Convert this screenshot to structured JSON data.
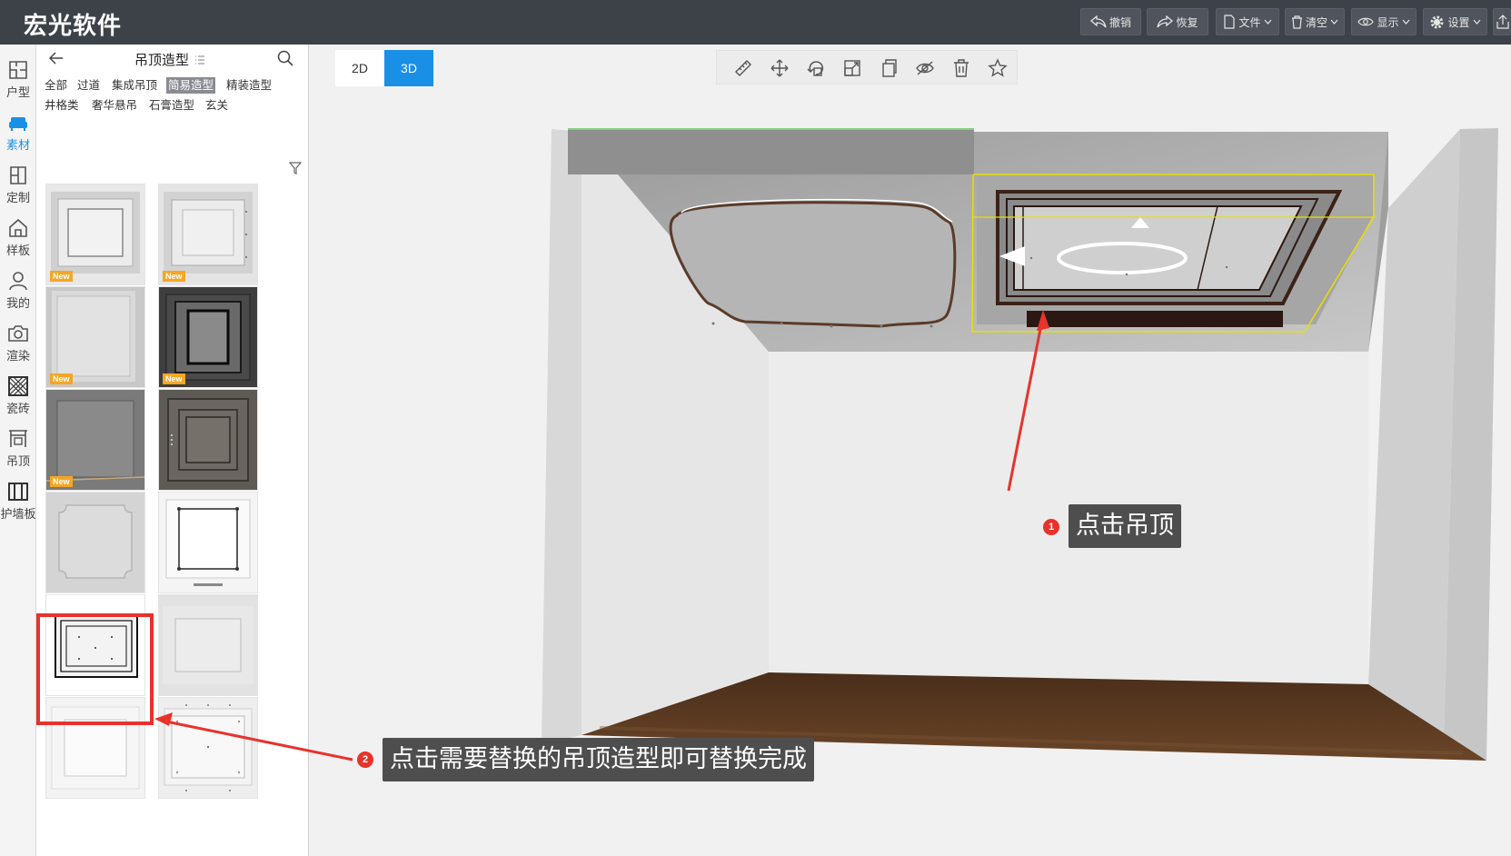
{
  "header": {
    "logo": "宏光软件",
    "buttons": {
      "undo": "撤销",
      "redo": "恢复",
      "file": "文件",
      "clear": "清空",
      "display": "显示",
      "settings": "设置"
    }
  },
  "rail": {
    "items": [
      {
        "label": "户型",
        "icon": "floorplan-icon"
      },
      {
        "label": "素材",
        "icon": "sofa-icon",
        "active": true
      },
      {
        "label": "定制",
        "icon": "custom-cabinet-icon"
      },
      {
        "label": "样板",
        "icon": "house-icon"
      },
      {
        "label": "我的",
        "icon": "user-icon"
      },
      {
        "label": "渲染",
        "icon": "camera-icon"
      },
      {
        "label": "瓷砖",
        "icon": "tile-icon"
      },
      {
        "label": "吊顶",
        "icon": "ceiling-icon"
      },
      {
        "label": "护墙板",
        "icon": "wall-panel-icon"
      }
    ]
  },
  "panel": {
    "title": "吊顶造型",
    "categories_row1": [
      "全部",
      "过道",
      "集成吊顶",
      "简易造型",
      "精装造型"
    ],
    "categories_row2": [
      "井格类",
      "奢华悬吊",
      "石膏造型",
      "玄关"
    ],
    "active_category": "简易造型",
    "thumbnails": [
      {
        "style": "light-panel",
        "new": true
      },
      {
        "style": "light-panel-dots",
        "new": true
      },
      {
        "style": "plain-frame",
        "new": true
      },
      {
        "style": "dark-frame",
        "new": true
      },
      {
        "style": "grey-recess",
        "new": true
      },
      {
        "style": "brown-frame",
        "new": false
      },
      {
        "style": "rounded-corner",
        "new": false
      },
      {
        "style": "light-with-dots",
        "new": false
      },
      {
        "style": "dark-line-grid",
        "new": false,
        "highlighted": true
      },
      {
        "style": "soft-frame",
        "new": false
      },
      {
        "style": "thin-frame",
        "new": false
      },
      {
        "style": "dotted-frame",
        "new": false
      }
    ],
    "new_tag": "New"
  },
  "viewport": {
    "mode_2d": "2D",
    "mode_3d": "3D",
    "active_mode": "3D",
    "tools": [
      "ruler-icon",
      "move-icon",
      "rotate-icon",
      "scale-icon",
      "copy-icon",
      "hide-icon",
      "delete-icon",
      "favorite-icon"
    ]
  },
  "annotations": {
    "step1_number": "1",
    "step1_text": "点击吊顶",
    "step2_number": "2",
    "step2_text": "点击需要替换的吊顶造型即可替换完成"
  },
  "colors": {
    "header_bg": "#3d4148",
    "accent_blue": "#1a8fe6",
    "annotation_red": "#e8322c",
    "callout_bg": "#4e4e4e",
    "floor_wood": "#5a3a22",
    "selection_yellow": "#e8e000"
  }
}
